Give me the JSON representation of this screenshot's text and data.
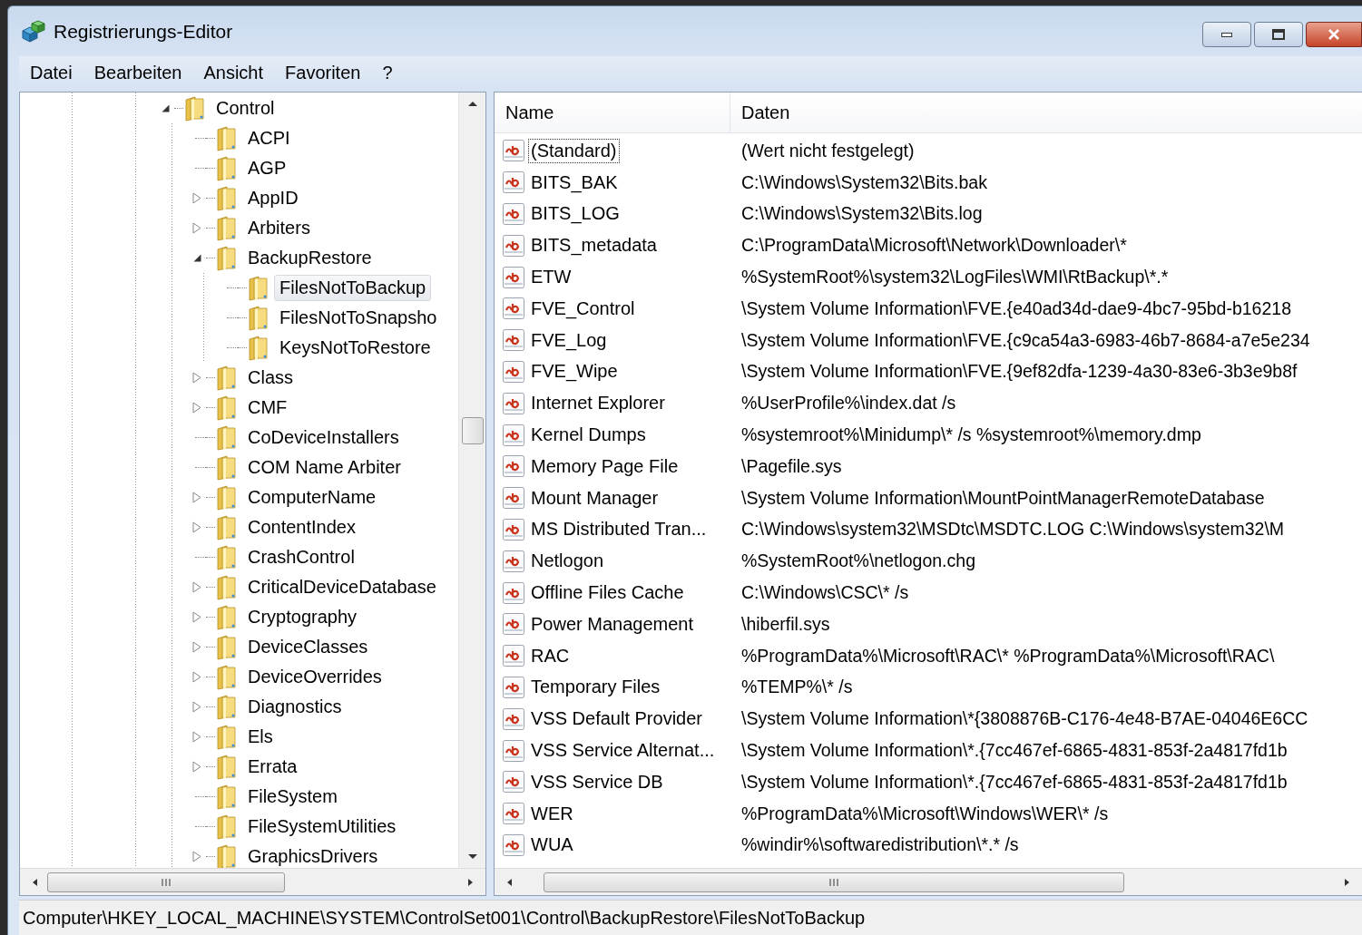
{
  "window": {
    "title": "Registrierungs-Editor"
  },
  "menu": [
    "Datei",
    "Bearbeiten",
    "Ansicht",
    "Favoriten",
    "?"
  ],
  "tree": [
    {
      "label": "Control",
      "kind": "expanded",
      "selected": false,
      "children": [
        {
          "label": "ACPI",
          "kind": "leaf",
          "selected": false
        },
        {
          "label": "AGP",
          "kind": "leaf",
          "selected": false
        },
        {
          "label": "AppID",
          "kind": "collapsed",
          "selected": false
        },
        {
          "label": "Arbiters",
          "kind": "collapsed",
          "selected": false
        },
        {
          "label": "BackupRestore",
          "kind": "expanded",
          "selected": false,
          "children": [
            {
              "label": "FilesNotToBackup",
              "kind": "leaf",
              "selected": true
            },
            {
              "label": "FilesNotToSnapsho",
              "kind": "leaf",
              "selected": false
            },
            {
              "label": "KeysNotToRestore",
              "kind": "leaf",
              "selected": false
            }
          ]
        },
        {
          "label": "Class",
          "kind": "collapsed",
          "selected": false
        },
        {
          "label": "CMF",
          "kind": "collapsed",
          "selected": false
        },
        {
          "label": "CoDeviceInstallers",
          "kind": "leaf",
          "selected": false
        },
        {
          "label": "COM Name Arbiter",
          "kind": "leaf",
          "selected": false
        },
        {
          "label": "ComputerName",
          "kind": "collapsed",
          "selected": false
        },
        {
          "label": "ContentIndex",
          "kind": "collapsed",
          "selected": false
        },
        {
          "label": "CrashControl",
          "kind": "leaf",
          "selected": false
        },
        {
          "label": "CriticalDeviceDatabase",
          "kind": "collapsed",
          "selected": false
        },
        {
          "label": "Cryptography",
          "kind": "collapsed",
          "selected": false
        },
        {
          "label": "DeviceClasses",
          "kind": "collapsed",
          "selected": false
        },
        {
          "label": "DeviceOverrides",
          "kind": "collapsed",
          "selected": false
        },
        {
          "label": "Diagnostics",
          "kind": "collapsed",
          "selected": false
        },
        {
          "label": "Els",
          "kind": "collapsed",
          "selected": false
        },
        {
          "label": "Errata",
          "kind": "collapsed",
          "selected": false
        },
        {
          "label": "FileSystem",
          "kind": "leaf",
          "selected": false
        },
        {
          "label": "FileSystemUtilities",
          "kind": "leaf",
          "selected": false
        },
        {
          "label": "GraphicsDrivers",
          "kind": "collapsed",
          "selected": false
        }
      ]
    }
  ],
  "values": {
    "columns": [
      "Name",
      "Daten"
    ],
    "rows": [
      {
        "name": "(Standard)",
        "data": "(Wert nicht festgelegt)",
        "selected": true
      },
      {
        "name": "BITS_BAK",
        "data": "C:\\Windows\\System32\\Bits.bak",
        "selected": false
      },
      {
        "name": "BITS_LOG",
        "data": "C:\\Windows\\System32\\Bits.log",
        "selected": false
      },
      {
        "name": "BITS_metadata",
        "data": "C:\\ProgramData\\Microsoft\\Network\\Downloader\\*",
        "selected": false
      },
      {
        "name": "ETW",
        "data": "%SystemRoot%\\system32\\LogFiles\\WMI\\RtBackup\\*.*",
        "selected": false
      },
      {
        "name": "FVE_Control",
        "data": "\\System Volume Information\\FVE.{e40ad34d-dae9-4bc7-95bd-b16218",
        "selected": false
      },
      {
        "name": "FVE_Log",
        "data": "\\System Volume Information\\FVE.{c9ca54a3-6983-46b7-8684-a7e5e234",
        "selected": false
      },
      {
        "name": "FVE_Wipe",
        "data": "\\System Volume Information\\FVE.{9ef82dfa-1239-4a30-83e6-3b3e9b8f",
        "selected": false
      },
      {
        "name": "Internet Explorer",
        "data": "%UserProfile%\\index.dat /s",
        "selected": false
      },
      {
        "name": "Kernel Dumps",
        "data": "%systemroot%\\Minidump\\* /s %systemroot%\\memory.dmp",
        "selected": false
      },
      {
        "name": "Memory Page File",
        "data": "\\Pagefile.sys",
        "selected": false
      },
      {
        "name": "Mount Manager",
        "data": "\\System Volume Information\\MountPointManagerRemoteDatabase",
        "selected": false
      },
      {
        "name": "MS Distributed Tran...",
        "data": "C:\\Windows\\system32\\MSDtc\\MSDTC.LOG C:\\Windows\\system32\\M",
        "selected": false
      },
      {
        "name": "Netlogon",
        "data": "%SystemRoot%\\netlogon.chg",
        "selected": false
      },
      {
        "name": "Offline Files Cache",
        "data": "C:\\Windows\\CSC\\* /s",
        "selected": false
      },
      {
        "name": "Power Management",
        "data": "\\hiberfil.sys",
        "selected": false
      },
      {
        "name": "RAC",
        "data": "%ProgramData%\\Microsoft\\RAC\\* %ProgramData%\\Microsoft\\RAC\\",
        "selected": false
      },
      {
        "name": "Temporary Files",
        "data": "%TEMP%\\* /s",
        "selected": false
      },
      {
        "name": "VSS Default Provider",
        "data": "\\System Volume Information\\*{3808876B-C176-4e48-B7AE-04046E6CC",
        "selected": false
      },
      {
        "name": "VSS Service Alternat...",
        "data": "\\System Volume Information\\*.{7cc467ef-6865-4831-853f-2a4817fd1b",
        "selected": false
      },
      {
        "name": "VSS Service DB",
        "data": "\\System Volume Information\\*.{7cc467ef-6865-4831-853f-2a4817fd1b",
        "selected": false
      },
      {
        "name": "WER",
        "data": "%ProgramData%\\Microsoft\\Windows\\WER\\* /s",
        "selected": false
      },
      {
        "name": "WUA",
        "data": "%windir%\\softwaredistribution\\*.* /s",
        "selected": false
      }
    ]
  },
  "status_bar": "Computer\\HKEY_LOCAL_MACHINE\\SYSTEM\\ControlSet001\\Control\\BackupRestore\\FilesNotToBackup"
}
